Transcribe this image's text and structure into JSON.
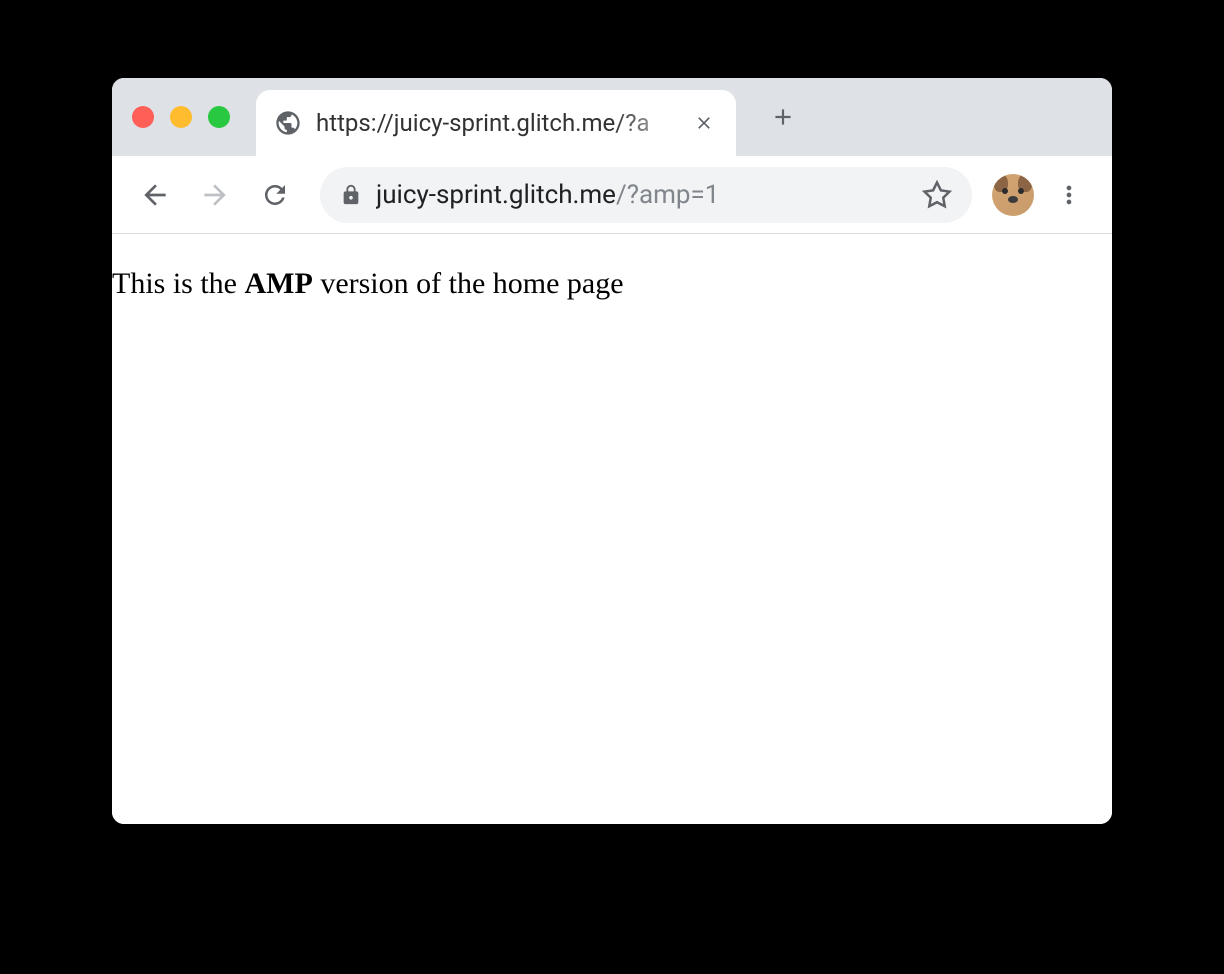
{
  "tab": {
    "title": "https://juicy-sprint.glitch.me/?a"
  },
  "address": {
    "host": "juicy-sprint.glitch.me",
    "path": "/?amp=1"
  },
  "page": {
    "text_before": "This is the ",
    "text_bold": "AMP",
    "text_after": " version of the home page"
  }
}
